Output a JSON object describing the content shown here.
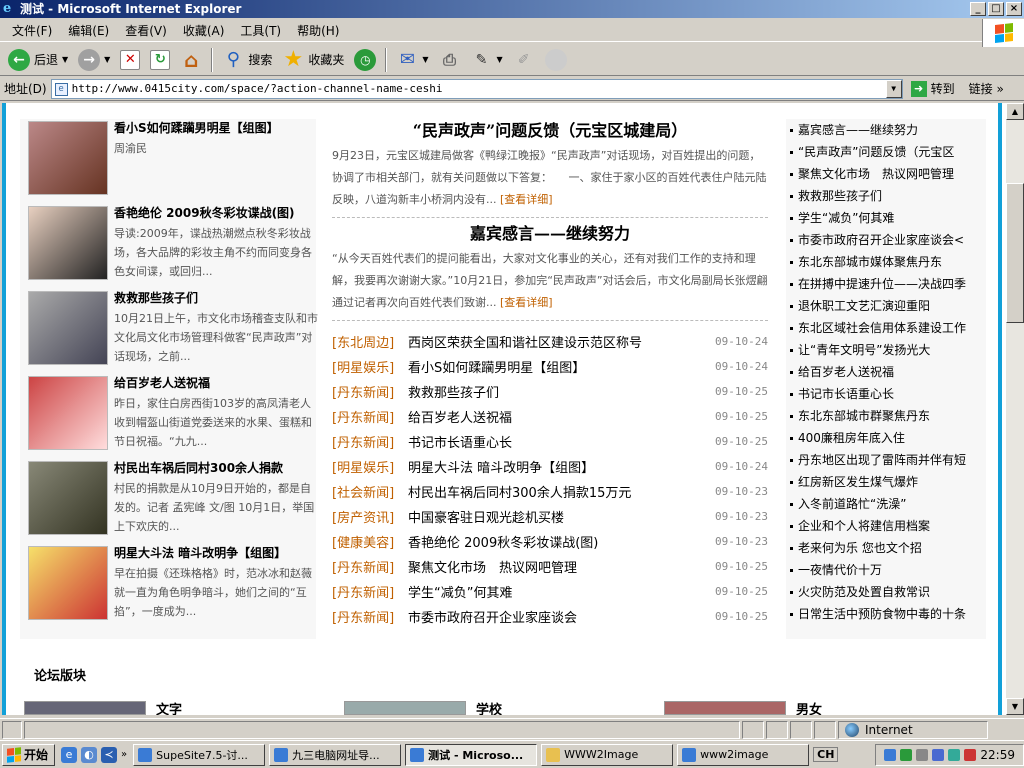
{
  "window": {
    "title": "测试 - Microsoft Internet Explorer",
    "minimize": "_",
    "maximize": "□",
    "close": "×"
  },
  "menu": [
    "文件(F)",
    "编辑(E)",
    "查看(V)",
    "收藏(A)",
    "工具(T)",
    "帮助(H)"
  ],
  "toolbar": {
    "back": "后退",
    "search": "搜索",
    "favorites": "收藏夹"
  },
  "address": {
    "label": "地址(D)",
    "url": "http://www.0415city.com/space/?action-channel-name-ceshi",
    "go": "转到",
    "links": "链接"
  },
  "left_cards": [
    {
      "title": "看小S如何蹂躏男明星【组图】",
      "desc": "周渝民"
    },
    {
      "title": "香艳绝伦 2009秋冬彩妆谍战(图)",
      "desc": "导读:2009年，谍战热潮燃点秋冬彩妆战场，各大品牌的彩妆主角不约而同变身各色女间谍，或回归..."
    },
    {
      "title": "救救那些孩子们",
      "desc": "10月21日上午，市文化市场稽查支队和市文化局文化市场管理科做客“民声政声”对话现场，之前..."
    },
    {
      "title": "给百岁老人送祝福",
      "desc": "昨日，家住白房西街103岁的高凤清老人收到帽盔山街道党委送来的水果、蛋糕和节日祝福。“九九..."
    },
    {
      "title": "村民出车祸后同村300余人捐款",
      "desc": "村民的捐款是从10月9日开始的，都是自发的。记者 孟宪峰 文/图 10月1日，举国上下欢庆的..."
    },
    {
      "title": "明星大斗法 暗斗改明争【组图】",
      "desc": "早在拍摄《还珠格格》时，范冰冰和赵薇就一直为角色明争暗斗，她们之间的“互掐”，一度成为..."
    }
  ],
  "featured": [
    {
      "title": "“民声政声”问题反馈（元宝区城建局）",
      "desc": "9月23日，元宝区城建局做客《鸭绿江晚报》“民声政声”对话现场，对百姓提出的问题，协调了市相关部门，就有关问题做以下答复：　　一、家住于家小区的百姓代表住户陆元陆反映，八道沟新丰小桥洞内没有...",
      "more": "[查看详细]"
    },
    {
      "title": "嘉宾感言——继续努力",
      "desc": "“从今天百姓代表们的提问能看出，大家对文化事业的关心，还有对我们工作的支持和理解，我要再次谢谢大家。”10月21日，参加完“民声政声”对话会后，市文化局副局长张熤翩通过记者再次向百姓代表们致谢...",
      "more": "[查看详细]"
    }
  ],
  "news": [
    {
      "cat": "[东北周边]",
      "title": "西岗区荣获全国和谐社区建设示范区称号",
      "date": "09-10-24"
    },
    {
      "cat": "[明星娱乐]",
      "title": "看小S如何蹂躏男明星【组图】",
      "date": "09-10-24"
    },
    {
      "cat": "[丹东新闻]",
      "title": "救救那些孩子们",
      "date": "09-10-25"
    },
    {
      "cat": "[丹东新闻]",
      "title": "给百岁老人送祝福",
      "date": "09-10-25"
    },
    {
      "cat": "[丹东新闻]",
      "title": "书记市长语重心长",
      "date": "09-10-25"
    },
    {
      "cat": "[明星娱乐]",
      "title": "明星大斗法 暗斗改明争【组图】",
      "date": "09-10-24"
    },
    {
      "cat": "[社会新闻]",
      "title": "村民出车祸后同村300余人捐款15万元",
      "date": "09-10-23"
    },
    {
      "cat": "[房产资讯]",
      "title": "中国豪客驻日观光趁机买楼",
      "date": "09-10-23"
    },
    {
      "cat": "[健康美容]",
      "title": "香艳绝伦 2009秋冬彩妆谍战(图)",
      "date": "09-10-23"
    },
    {
      "cat": "[丹东新闻]",
      "title": "聚焦文化市场　热议网吧管理",
      "date": "09-10-25"
    },
    {
      "cat": "[丹东新闻]",
      "title": "学生“减负”何其难",
      "date": "09-10-25"
    },
    {
      "cat": "[丹东新闻]",
      "title": "市委市政府召开企业家座谈会",
      "date": "09-10-25"
    }
  ],
  "right_list": [
    "嘉宾感言——继续努力",
    "“民声政声”问题反馈（元宝区",
    "聚焦文化市场　热议网吧管理",
    "救救那些孩子们",
    "学生“减负”何其难",
    "市委市政府召开企业家座谈会<",
    "东北东部城市媒体聚焦丹东",
    "在拼搏中提速升位——决战四季",
    "退休职工文艺汇演迎重阳",
    "东北区域社会信用体系建设工作",
    "让“青年文明号”发扬光大",
    "给百岁老人送祝福",
    "书记市长语重心长",
    "东北东部城市群聚焦丹东",
    "400廉租房年底入住",
    "丹东地区出现了雷阵雨并伴有短",
    "红房新区发生煤气爆炸",
    "入冬前道路忙“洗澡”",
    "企业和个人将建信用档案",
    "老来何为乐 您也文个招",
    "一夜情代价十万",
    "火灾防范及处置自救常识",
    "日常生活中预防食物中毒的十条"
  ],
  "forum": {
    "heading": "论坛版块",
    "cats": [
      "文字",
      "学校",
      "男女"
    ]
  },
  "status": {
    "zone": "Internet"
  },
  "taskbar": {
    "start": "开始",
    "tasks": [
      "SupeSite7.5-讨...",
      "九三电脑网址导...",
      "测试 - Microso...",
      "WWW2Image",
      "www2image"
    ],
    "ime": "CH",
    "clock": "22:59"
  }
}
